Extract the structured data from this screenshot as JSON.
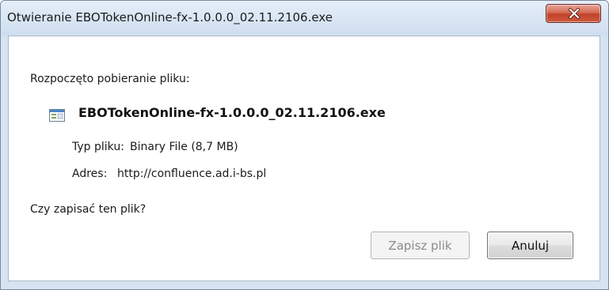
{
  "window": {
    "title": "Otwieranie EBOTokenOnline-fx-1.0.0.0_02.11.2106.exe",
    "close_icon": "close-icon"
  },
  "dialog": {
    "intro": "Rozpoczęto pobieranie pliku:",
    "file_icon": "executable-file-icon",
    "file_name": "EBOTokenOnline-fx-1.0.0.0_02.11.2106.exe",
    "type_label": "Typ pliku:",
    "type_value": "Binary File (8,7 MB)",
    "address_label": "Adres:",
    "address_value": "http://confluence.ad.i-bs.pl",
    "question": "Czy zapisać ten plik?"
  },
  "buttons": {
    "save_label": "Zapisz plik",
    "cancel_label": "Anuluj"
  },
  "colors": {
    "titlebar": "#d9e6f4",
    "close_button": "#c2422b"
  }
}
